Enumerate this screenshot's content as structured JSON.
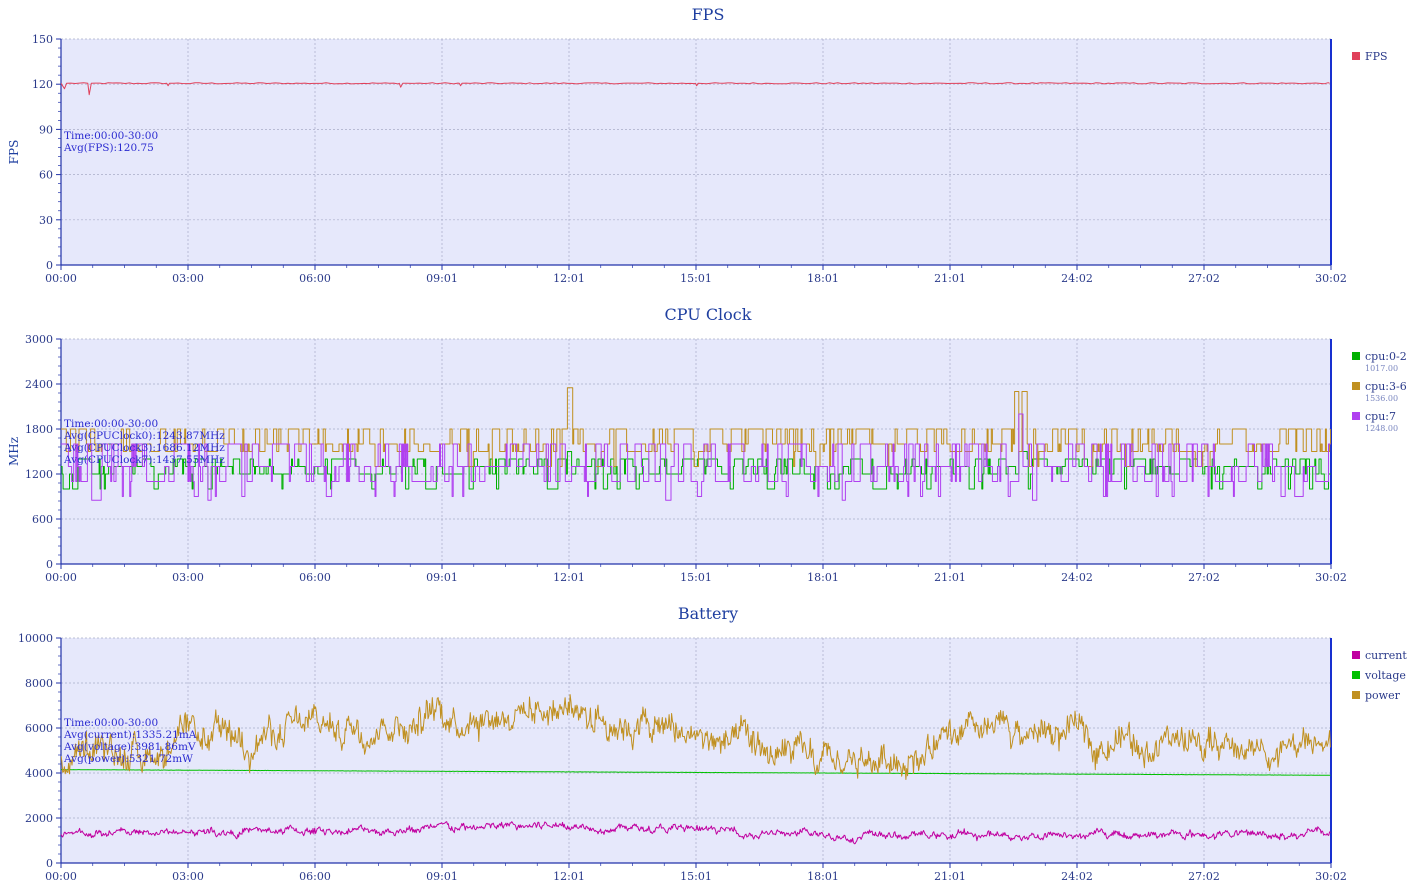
{
  "chart_data": [
    {
      "type": "line",
      "title": "FPS",
      "ylabel": "FPS",
      "ylim": [
        0,
        150
      ],
      "y_ticks": [
        "0",
        "30",
        "60",
        "90",
        "120",
        "150"
      ],
      "x_ticks": [
        "00:00",
        "03:00",
        "06:00",
        "09:01",
        "12:01",
        "15:01",
        "18:01",
        "21:01",
        "24:02",
        "27:02",
        "30:02"
      ],
      "grid": true,
      "legend_position": "right",
      "annotations": [
        "Time:00:00-30:00",
        "Avg(FPS):120.75"
      ],
      "series": [
        {
          "name": "FPS",
          "color": "#e0405a",
          "baseline": 120.6,
          "points": [
            [
              0,
              120.6
            ],
            [
              5,
              117
            ],
            [
              8,
              120.6
            ],
            [
              38,
              120.6
            ],
            [
              40,
              113
            ],
            [
              43,
              120.6
            ],
            [
              150,
              120.6
            ],
            [
              152,
              119
            ],
            [
              154,
              120.6
            ],
            [
              480,
              120.6
            ],
            [
              482,
              118
            ],
            [
              485,
              120.6
            ],
            [
              565,
              120.6
            ],
            [
              567,
              119
            ],
            [
              569,
              120.6
            ],
            [
              900,
              120.6
            ],
            [
              902,
              119
            ],
            [
              904,
              120.6
            ],
            [
              1800,
              120.6
            ]
          ]
        }
      ]
    },
    {
      "type": "line",
      "title": "CPU Clock",
      "ylabel": "MHz",
      "ylim": [
        0,
        3000
      ],
      "y_ticks": [
        "0",
        "600",
        "1200",
        "1800",
        "2400",
        "3000"
      ],
      "x_ticks": [
        "00:00",
        "03:00",
        "06:00",
        "09:01",
        "12:01",
        "15:01",
        "18:01",
        "21:01",
        "24:02",
        "27:02",
        "30:02"
      ],
      "grid": true,
      "legend_position": "right",
      "annotations": [
        "Time:00:00-30:00",
        "Avg(CPUClock0):1243.87MHz",
        "Avg(CPUClock3):1686.12MHz",
        "Avg(CPUClock7):1437.55MHz"
      ],
      "series": [
        {
          "name": "cpu:0-2",
          "value_label": "1017.00",
          "color": "#00b000",
          "base": 1300,
          "levels": [
            1200,
            1300,
            1400
          ],
          "dips": [
            [
              5,
              1000
            ],
            [
              18,
              1000
            ],
            [
              210,
              1000
            ],
            [
              520,
              1000
            ],
            [
              720,
              1000
            ],
            [
              1100,
              1000
            ],
            [
              1290,
              1000
            ],
            [
              1700,
              1000
            ],
            [
              1795,
              1000
            ]
          ],
          "spikes": [
            [
              720,
              1500
            ],
            [
              1360,
              1500
            ]
          ]
        },
        {
          "name": "cpu:3-6",
          "value_label": "1536.00",
          "color": "#c09020",
          "base": 1800,
          "levels": [
            1500,
            1600,
            1800
          ],
          "dips": [],
          "spikes": [
            [
              720,
              2350
            ],
            [
              1355,
              2300
            ],
            [
              1365,
              2300
            ]
          ]
        },
        {
          "name": "cpu:7",
          "value_label": "1248.00",
          "color": "#b040f0",
          "base": 1600,
          "levels": [
            1100,
            1300,
            1600
          ],
          "dips": [
            [
              45,
              850
            ],
            [
              210,
              850
            ],
            [
              860,
              850
            ],
            [
              1110,
              850
            ],
            [
              1380,
              850
            ]
          ],
          "spikes": [
            [
              1360,
              2000
            ]
          ]
        }
      ]
    },
    {
      "type": "line",
      "title": "Battery",
      "ylim": [
        0,
        10000
      ],
      "y_ticks": [
        "0",
        "2000",
        "4000",
        "6000",
        "8000",
        "10000"
      ],
      "x_ticks": [
        "00:00",
        "03:00",
        "06:00",
        "09:01",
        "12:01",
        "15:01",
        "18:01",
        "21:01",
        "24:02",
        "27:02",
        "30:02"
      ],
      "grid": true,
      "legend_position": "right",
      "annotations": [
        "Time:00:00-30:00",
        "Avg(current):1335.21mA",
        "Avg(voltage):3981.86mV",
        "Avg(power):5321.72mW"
      ],
      "series": [
        {
          "name": "current",
          "color": "#c000a0",
          "trend": [
            [
              0,
              1300
            ],
            [
              540,
              1500
            ],
            [
              720,
              1700
            ],
            [
              1090,
              1200
            ],
            [
              1800,
              1300
            ]
          ]
        },
        {
          "name": "voltage",
          "color": "#00c000",
          "trend": [
            [
              0,
              4150
            ],
            [
              1800,
              3900
            ]
          ]
        },
        {
          "name": "power",
          "color": "#c09020",
          "trend": [
            [
              0,
              4500
            ],
            [
              200,
              5400
            ],
            [
              540,
              6600
            ],
            [
              720,
              7000
            ],
            [
              900,
              5600
            ],
            [
              1090,
              4200
            ],
            [
              1350,
              5800
            ],
            [
              1800,
              4900
            ]
          ]
        }
      ]
    }
  ]
}
